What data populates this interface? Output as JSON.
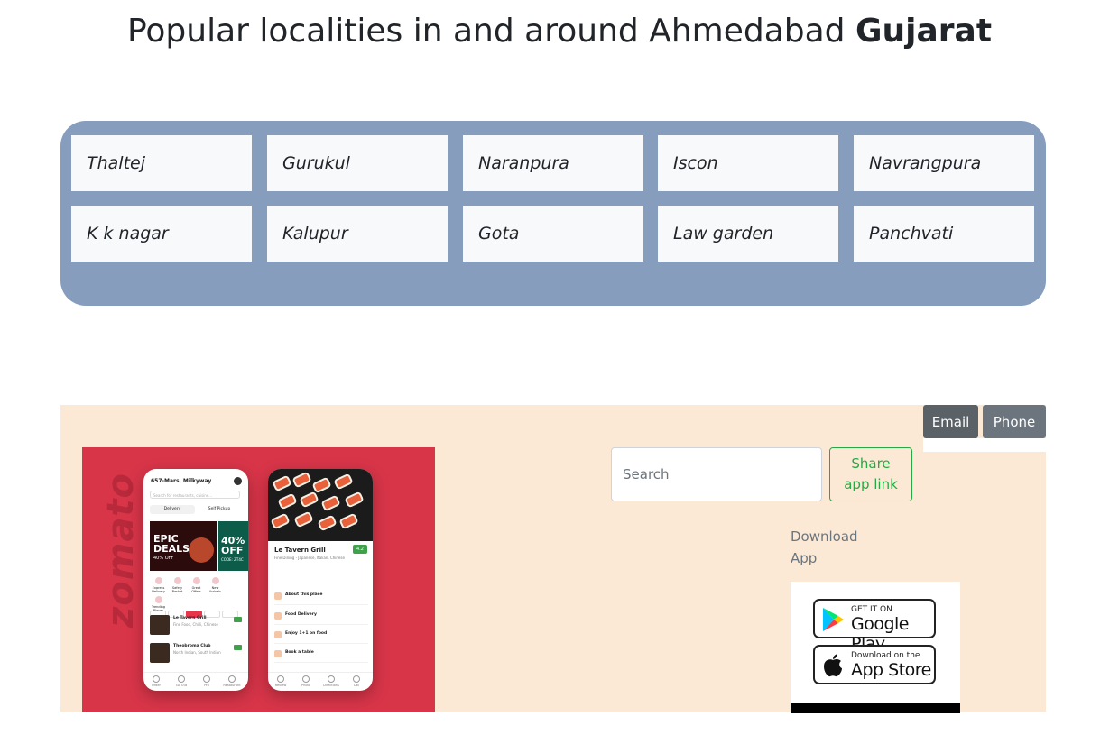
{
  "heading": {
    "prefix": "Popular localities in and around Ahmedabad ",
    "state": "Gujarat"
  },
  "localities": [
    "Thaltej",
    "Gurukul",
    "Naranpura",
    "Iscon",
    "Navrangpura",
    "K k nagar",
    "Kalupur",
    "Gota",
    "Law garden",
    "Panchvati"
  ],
  "contact": {
    "email_label": "Email",
    "phone_label": "Phone"
  },
  "search": {
    "placeholder": "Search"
  },
  "share": {
    "label_line1": "Share",
    "label_line2": "app link"
  },
  "download": {
    "label_line1": "Download",
    "label_line2": "App"
  },
  "stores": {
    "google": {
      "small": "GET IT ON",
      "big": "Google Play"
    },
    "apple": {
      "small": "Download on the",
      "big": "App Store"
    }
  },
  "promo": {
    "brand": "zomato",
    "phone1": {
      "location": "657-Mars, Milkyway",
      "search_placeholder": "Search for restaurants, cuisine...",
      "tab_delivery": "Delivery",
      "tab_pickup": "Self Pickup",
      "deal1_title": "EPIC DEALS",
      "deal1_sub": "40% OFF",
      "deal2_title": "40% OFF",
      "deal2_sub": "CODE: ZT4C",
      "categories": [
        "Express Delivery",
        "Safety Basket",
        "Great Offers",
        "New Arrivals",
        "Trending Places"
      ],
      "rows": [
        {
          "name": "Le Tavern Grill",
          "sub": "Fine Food, Chilli, Chinese"
        },
        {
          "name": "Theobroma Club",
          "sub": "North Indian, South Indian"
        }
      ],
      "nav": [
        "Order",
        "Go Out",
        "Pro",
        "Restaurant"
      ]
    },
    "phone2": {
      "name": "Le Tavern Grill",
      "rating": "4.2",
      "sub": "Fine Dining - Japanese, Italian, Chinese",
      "items": [
        "About this place",
        "Food Delivery",
        "Enjoy 1+1 on food",
        "Book a table"
      ],
      "nav": [
        "Review",
        "Photo",
        "Directions",
        "Call"
      ]
    }
  },
  "colors": {
    "localities_bg": "#869dbd",
    "footer_bg": "#fbe9d5",
    "email_btn": "#5a6268",
    "phone_btn": "#6c757d",
    "share_green": "#28a745",
    "promo_red": "#d93549"
  }
}
